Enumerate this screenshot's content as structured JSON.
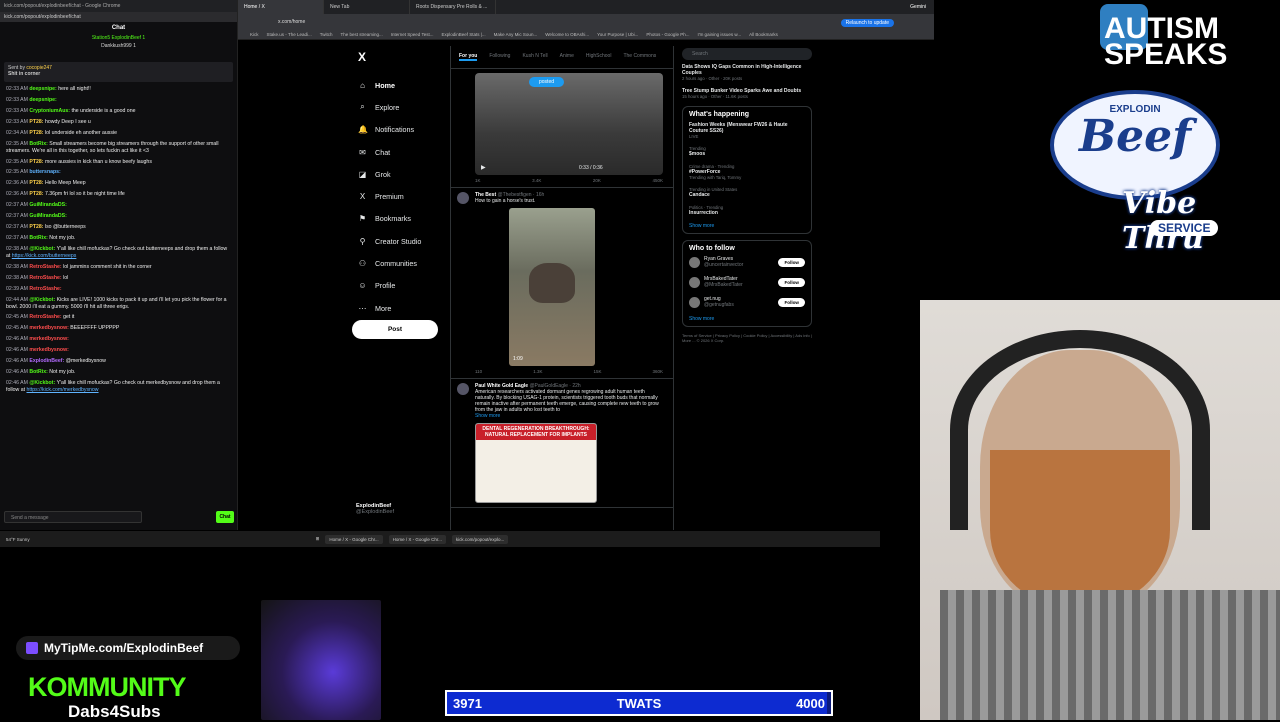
{
  "chat": {
    "window_title": "kick.com/popout/explodinbeef/chat - Google Chrome",
    "url": "kick.com/popout/explodinbeef/chat",
    "header": "Chat",
    "stats_line1": "Station5 ExplodinBeef 1",
    "stats_line2": "Dankkush999 1",
    "sent_by": "Sent by",
    "sent_by_user": "cocopie247",
    "pinned_text": "Shit in corner",
    "input_placeholder": "Send a message",
    "send_label": "Chat",
    "messages": [
      {
        "time": "02:33 AM",
        "user": "deepsnipe:",
        "text": "here all night!!",
        "color": "#53fc18"
      },
      {
        "time": "02:33 AM",
        "user": "deepsnipe:",
        "text": "",
        "color": "#53fc18"
      },
      {
        "time": "02:33 AM",
        "user": "CryptoniumAus:",
        "text": "the underside is a good one",
        "color": "#53fc18"
      },
      {
        "time": "02:33 AM",
        "user": "PT28:",
        "text": "howdy Deep I see u",
        "color": "#ffd24a"
      },
      {
        "time": "02:34 AM",
        "user": "PT28:",
        "text": "lol underside eh another aussie",
        "color": "#ffd24a"
      },
      {
        "time": "02:35 AM",
        "user": "BotRix:",
        "text": "Small streamers become big streamers through the support of other small streamers. We're all in this together, so lets fuckin act like it <3",
        "color": "#53fc18"
      },
      {
        "time": "02:35 AM",
        "user": "PT28:",
        "text": "more aussies in kick than u know beefy laughs",
        "color": "#ffd24a"
      },
      {
        "time": "02:35 AM",
        "user": "buttersnaps:",
        "text": "",
        "color": "#5fb3ff"
      },
      {
        "time": "02:36 AM",
        "user": "PT28:",
        "text": "Hello Meep Meep",
        "color": "#ffd24a"
      },
      {
        "time": "02:36 AM",
        "user": "PT28:",
        "text": "7.36pm fri lol so it be night time life",
        "color": "#ffd24a"
      },
      {
        "time": "02:37 AM",
        "user": "GuiMirandaDS:",
        "text": "",
        "color": "#53fc18"
      },
      {
        "time": "02:37 AM",
        "user": "GuiMirandaDS:",
        "text": "",
        "color": "#53fc18"
      },
      {
        "time": "02:37 AM",
        "user": "PT28:",
        "text": "lso @butterneeps",
        "color": "#ffd24a"
      },
      {
        "time": "02:37 AM",
        "user": "BotRix:",
        "text": "Not my job.",
        "color": "#53fc18"
      },
      {
        "time": "02:38 AM",
        "user": "@Kickbot:",
        "text": "Y'all like chill mofuckas? Go check out butterneeps and drop them a follow at",
        "link": "https://kick.com/butterneeps",
        "color": "#53fc18"
      },
      {
        "time": "02:38 AM",
        "user": "RetroStashe:",
        "text": "lol jammins comment shit in the corner",
        "color": "#ff4d4d"
      },
      {
        "time": "02:38 AM",
        "user": "RetroStashe:",
        "text": "lol",
        "color": "#ff4d4d"
      },
      {
        "time": "02:39 AM",
        "user": "RetroStashe:",
        "text": "",
        "color": "#ff4d4d"
      },
      {
        "time": "02:44 AM",
        "user": "@Kickbot:",
        "text": "Kicks are LIVE! 1000 kicks to pack it up and i'll let you pick the flower for a bowl. 2000 i'll eat a gummy. 5000 i'll hit all three erigs.",
        "color": "#53fc18"
      },
      {
        "time": "02:45 AM",
        "user": "RetroStashe:",
        "text": "get it",
        "color": "#ff4d4d"
      },
      {
        "time": "02:45 AM",
        "user": "merkedbysnow:",
        "text": "BEEEFFFF UPPPPP",
        "color": "#ff4d4d"
      },
      {
        "time": "02:46 AM",
        "user": "merkedbysnow:",
        "text": "",
        "color": "#ff4d4d"
      },
      {
        "time": "02:46 AM",
        "user": "merkedbysnow:",
        "text": "",
        "color": "#ff4d4d"
      },
      {
        "time": "02:46 AM",
        "user": "ExplodinBeef:",
        "text": "@merkedbysnow",
        "color": "#b36bff"
      },
      {
        "time": "02:46 AM",
        "user": "BotRix:",
        "text": "Not my job.",
        "color": "#53fc18"
      },
      {
        "time": "02:46 AM",
        "user": "@Kickbot:",
        "text": "Y'all like chill mofuckas? Go check out merkedbysnow and drop them a follow at",
        "link": "https://kick.com/merkedbysnow",
        "color": "#53fc18"
      }
    ]
  },
  "browser": {
    "tabs": [
      "Home / X",
      "New Tab",
      "Roots Dispensary Pre Rolls & ..."
    ],
    "address": "x.com/home",
    "bookmarks": [
      "Kick",
      "Stake.us - The Leadi...",
      "Twitch",
      "The best streaming...",
      "Internet Speed Test...",
      "ExplodinBeef Stats |...",
      "Make Any Mic Soun...",
      "Welcome to OBAshi...",
      "Your Purpose | Ubi...",
      "Photos - Google Ph...",
      "I'm gaining issues w...",
      "All Bookmarks"
    ],
    "gemini": "Gemini",
    "relaunch": "Relaunch to update"
  },
  "xnav": {
    "logo": "X",
    "items": [
      {
        "label": "Home",
        "icon": "⌂"
      },
      {
        "label": "Explore",
        "icon": "⌕"
      },
      {
        "label": "Notifications",
        "icon": "🔔"
      },
      {
        "label": "Chat",
        "icon": "✉"
      },
      {
        "label": "Grok",
        "icon": "◪"
      },
      {
        "label": "Premium",
        "icon": "X"
      },
      {
        "label": "Bookmarks",
        "icon": "⚑"
      },
      {
        "label": "Creator Studio",
        "icon": "⚲"
      },
      {
        "label": "Communities",
        "icon": "⚇"
      },
      {
        "label": "Profile",
        "icon": "☺"
      },
      {
        "label": "More",
        "icon": "⋯"
      }
    ],
    "post": "Post",
    "profile_name": "ExplodinBeef",
    "profile_handle": "@ExplodinBeef"
  },
  "feed": {
    "tabs": [
      "For you",
      "Following",
      "Kush N Tell",
      "Anime",
      "HighSchool",
      "The Commons"
    ],
    "posted_pill": "posted",
    "video_time": "0:33 / 0:36",
    "t1_acts": [
      "1K",
      "3.4K",
      "20K",
      "450K"
    ],
    "t2_name": "The Best",
    "t2_handle": "@Thebestfigen · 16h",
    "t2_text": "How to gain a horse's trust.",
    "t2_time": "1:09",
    "t2_acts": [
      "110",
      "1.3K",
      "15K",
      "360K"
    ],
    "t3_name": "Paul White Gold Eagle",
    "t3_handle": "@PaulGoldEagle · 22h",
    "t3_text": "American researchers activated dormant genes regrowing adult human teeth naturally. By blocking USAG-1 protein, scientists triggered tooth buds that normally remain inactive after permanent teeth emerge, causing complete new teeth to grow from the jaw in adults who lost teeth to",
    "t3_more": "Show more",
    "t3_img_title": "DENTAL REGENERATION BREAKTHROUGH: NATURAL REPLACEMENT FOR IMPLANTS"
  },
  "rcol": {
    "search": "Search",
    "trend_top": [
      {
        "title": "Data Shows IQ Gaps Common in High-Intelligence Couples",
        "meta": "2 hours ago · Other · 20K posts"
      },
      {
        "title": "Tree Stump Bunker Video Sparks Awe and Doubts",
        "meta": "15 hours ago · Other · 11.6K posts"
      }
    ],
    "happening_title": "What's happening",
    "happening_event": "Fashion Weeks (Menswear FW26 & Haute Couture SS26)",
    "happening_live": "LIVE",
    "trends": [
      {
        "cat": "Trending",
        "title": "$moos"
      },
      {
        "cat": "Crime drama · Trending",
        "title": "#PowerForce",
        "extra": "Trending with Tariq, Tommy"
      },
      {
        "cat": "Trending in United States",
        "title": "Candace"
      },
      {
        "cat": "Politics · Trending",
        "title": "Insurrection"
      }
    ],
    "show_more": "Show more",
    "wtf_title": "Who to follow",
    "follows": [
      {
        "name": "Ryan Graves",
        "handle": "@uncertainvector"
      },
      {
        "name": "MrsBakedTater",
        "handle": "@MrsBakedTater"
      },
      {
        "name": "get.nug",
        "handle": "@getnugfabs"
      }
    ],
    "follow_label": "Follow",
    "footer": "Terms of Service | Privacy Policy | Cookie Policy | Accessibility | Ads info | More ... © 2026 X Corp."
  },
  "taskbar": {
    "weather": "54°F Sunny",
    "items": [
      "Home / X - Google Chr...",
      "Home / X - Google Chr...",
      "kick.com/popout/explo..."
    ]
  },
  "overlay": {
    "tipme": "MyTipMe.com/ExplodinBeef",
    "kommunity": "KOMMUNITY",
    "dabs": "Dabs4Subs",
    "goal_left": "3971",
    "goal_label": "TWATS",
    "goal_right": "4000",
    "goal_progress": 0.99,
    "autism_line1": "AUTISM",
    "autism_line2": "SPEAKS",
    "logo_top": "EXPLODIN",
    "logo_mid": "Beef",
    "logo_script": "Vibe Thru",
    "logo_service": "SERVICE"
  },
  "colors": {
    "accent": "#1d9bf0",
    "kick_green": "#53fc18",
    "goal_bg": "#0b1a7a"
  }
}
